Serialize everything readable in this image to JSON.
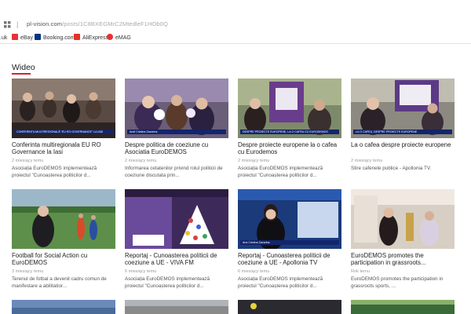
{
  "browser": {
    "url_host": "pl-vision.com",
    "url_path": "/posts/1C8BXEGMrC2MtedleF1HOb0Q"
  },
  "bookmarks": [
    {
      "label": ".uk",
      "color": ""
    },
    {
      "label": "eBay",
      "color": "#e53238"
    },
    {
      "label": "Booking.com",
      "color": "#003580"
    },
    {
      "label": "AliExpress",
      "color": "#e43225"
    },
    {
      "label": "eMAG",
      "color": "#e8312f"
    }
  ],
  "section": {
    "title": "Wideo",
    "accent": "#d2232a"
  },
  "videos": [
    {
      "caption": "CONFERINȚA MULTIREGIONALĂ \"EU RO GOVERNANCE\" LA IAȘI",
      "title": "Conferinta multiregionala EU RO Governance la Iasi",
      "meta": "2 miesiący temu",
      "desc": "Asociația EuroDEMOS implementează proiectul \"Cunoașterea politicilor d..."
    },
    {
      "caption": "Andi Cristina Zavorina",
      "title": "Despre politica de coeziune cu Asociatia EuroDEMOS",
      "meta": "2 miesiący temu",
      "desc": "Informarea cetatenilor privind rolul politicii de coeziune discutata prin..."
    },
    {
      "caption": "DESPRE PROIECTE EUROPENE, LA O CAFEA CU EURODEMOS",
      "title": "Despre proiecte europene la o cafea cu Eurodemos",
      "meta": "2 miesiący temu",
      "desc": "Asociația EuroDEMOS implementează proiectul \"Cunoașterea politicilor d..."
    },
    {
      "caption": "LA O CAFEA, DESPRE PROIECTE EUROPENE",
      "title": "La o cafea despre proiecte europene",
      "meta": "2 miesiący temu",
      "desc": "Stire cafenele publice - Apollonia TV."
    },
    {
      "caption": "",
      "title": "Football for Social Action cu EuroDEMOS",
      "meta": "3 miesiący temu",
      "desc": "Terenul de fotbal a devenit cadru comun de manifestare a abilitatior..."
    },
    {
      "caption": "",
      "title": "Reportaj - Cunoasterea politicii de coeziune a UE - VIVA FM",
      "meta": "6 miesiący temu",
      "desc": "Asociația EuroDEMOS implementează proiectul \"Cunoașterea politicilor d..."
    },
    {
      "caption": "Ana Cristina Zavorina",
      "title": "Reportaj - Cunoasterea politicii de coeziune a UE - Apollonia TV",
      "meta": "6 miesiący temu",
      "desc": "Asociația EuroDEMOS implementează proiectul \"Cunoașterea politicilor d..."
    },
    {
      "caption": "",
      "title": "EuroDEMOS promotes the participation in grassroots...",
      "meta": "Rok temu",
      "desc": "EuroDEMOS promotes the participation in grassroots sports, ..."
    }
  ]
}
